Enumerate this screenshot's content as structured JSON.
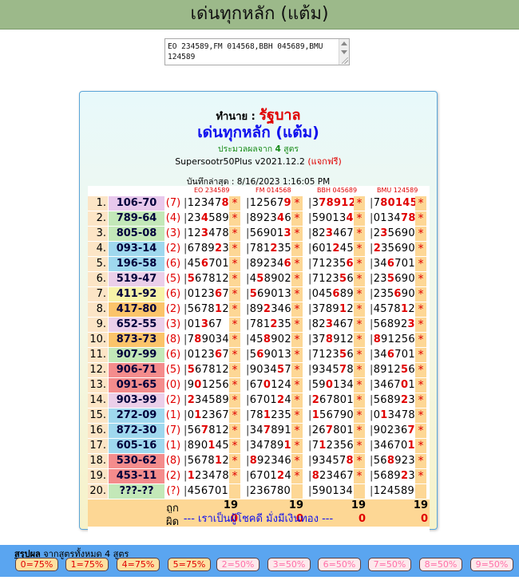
{
  "page": {
    "title": "เด่นทุกหลัก (แต้ม)"
  },
  "input": {
    "value": "EO 234589,FM 014568,BBH 045689,BMU 124589"
  },
  "panel": {
    "agent_label": "ทำนาย :",
    "agent_name": "รัฐบาล",
    "title": "เด่นทุกหลัก (แต้ม)",
    "subtitle_pre": "ประมวลผลจาก",
    "subtitle_num": "4",
    "subtitle_post": "สูตร",
    "version": "Supersootr50Plus v2021.12.2",
    "version_note": "(แจกฟรี)",
    "saved": "บันทึกล่าสุด : 8/16/2023 1:16:05 PM",
    "headers": [
      "EO 234589",
      "FM 014568",
      "BBH 045689",
      "BMU 124589"
    ],
    "footer": "--- เราเป็นผู้โชคดี มั่งมีเงินทอง ---"
  },
  "rows": [
    {
      "n": "1.",
      "pair": "106-70",
      "color": "#e8c8ec",
      "d": "(7)",
      "cells": [
        [
          "12347",
          "8"
        ],
        [
          "12567",
          "9"
        ],
        [
          "3",
          "78912"
        ],
        [
          "7",
          "80145"
        ]
      ],
      "stars": [
        1,
        1,
        1,
        1
      ]
    },
    {
      "n": "2.",
      "pair": "789-64",
      "color": "#c3e8b8",
      "d": "(4)",
      "cells": [
        [
          "23",
          "4",
          "589"
        ],
        [
          "8923",
          "4",
          "6"
        ],
        [
          "59013",
          "4"
        ],
        [
          "0134",
          "78"
        ]
      ],
      "stars": [
        1,
        1,
        1,
        1
      ]
    },
    {
      "n": "3.",
      "pair": "805-08",
      "color": "#c3e8b8",
      "d": "(3)",
      "cells": [
        [
          "12",
          "3",
          "478"
        ],
        [
          "56901",
          "3"
        ],
        [
          "82",
          "3",
          "467"
        ],
        [
          "2",
          "3",
          "5690"
        ]
      ],
      "stars": [
        1,
        1,
        1,
        1
      ]
    },
    {
      "n": "4.",
      "pair": "093-14",
      "color": "#9fd8ee",
      "d": "(2)",
      "cells": [
        [
          "6789",
          "2",
          "3"
        ],
        [
          "781",
          "2",
          "35"
        ],
        [
          "601",
          "2",
          "45"
        ],
        [
          "",
          "2",
          "35690"
        ]
      ],
      "stars": [
        1,
        1,
        1,
        1
      ]
    },
    {
      "n": "5.",
      "pair": "196-58",
      "color": "#9fd8ee",
      "d": "(6)",
      "cells": [
        [
          "45",
          "6",
          "701"
        ],
        [
          "89234",
          "6"
        ],
        [
          "71235",
          "6"
        ],
        [
          "34",
          "6",
          "701"
        ]
      ],
      "stars": [
        1,
        1,
        1,
        1
      ]
    },
    {
      "n": "6.",
      "pair": "519-47",
      "color": "#ebcfe9",
      "d": "(5)",
      "cells": [
        [
          "",
          "5",
          "67812"
        ],
        [
          "4",
          "5",
          "8902"
        ],
        [
          "7123",
          "5",
          "6"
        ],
        [
          "23",
          "5",
          "690"
        ]
      ],
      "stars": [
        1,
        1,
        1,
        1
      ]
    },
    {
      "n": "7.",
      "pair": "411-92",
      "color": "#f7f3a8",
      "d": "(6)",
      "cells": [
        [
          "0123",
          "6",
          "7"
        ],
        [
          "",
          "5",
          "69013"
        ],
        [
          "045",
          "6",
          "89"
        ],
        [
          "235",
          "6",
          "90"
        ]
      ],
      "stars": [
        1,
        1,
        1,
        1
      ]
    },
    {
      "n": "8.",
      "pair": "417-80",
      "color": "#fbc46a",
      "d": "(2)",
      "cells": [
        [
          "5678",
          "1",
          "2"
        ],
        [
          "89",
          "2",
          "346"
        ],
        [
          "3789",
          "1",
          "2"
        ],
        [
          "4578",
          "1",
          "2"
        ]
      ],
      "stars": [
        1,
        1,
        1,
        1
      ]
    },
    {
      "n": "9.",
      "pair": "652-55",
      "color": "#ebcfe9",
      "d": "(3)",
      "cells": [
        [
          "01",
          "3",
          "67"
        ],
        [
          "781",
          "2",
          "35"
        ],
        [
          "82",
          "3",
          "467"
        ],
        [
          "56892",
          "3"
        ]
      ],
      "stars": [
        1,
        1,
        1,
        1
      ]
    },
    {
      "n": "10.",
      "pair": "873-73",
      "color": "#fbc46a",
      "d": "(8)",
      "cells": [
        [
          "7",
          "8",
          "9034"
        ],
        [
          "45",
          "8",
          "902"
        ],
        [
          "37",
          "8",
          "912"
        ],
        [
          "",
          "8",
          "91256"
        ]
      ],
      "stars": [
        1,
        1,
        1,
        1
      ]
    },
    {
      "n": "11.",
      "pair": "907-99",
      "color": "#c3e8b8",
      "d": "(6)",
      "cells": [
        [
          "0123",
          "6",
          "7"
        ],
        [
          "5",
          "6",
          "9013"
        ],
        [
          "7123",
          "5",
          "6"
        ],
        [
          "34",
          "6",
          "701"
        ]
      ],
      "stars": [
        1,
        1,
        1,
        1
      ]
    },
    {
      "n": "12.",
      "pair": "906-71",
      "color": "#f48c8c",
      "d": "(5)",
      "cells": [
        [
          "",
          "5",
          "67812"
        ],
        [
          "9034",
          "5",
          "7"
        ],
        [
          "9345",
          "7",
          "8"
        ],
        [
          "8912",
          "5",
          "6"
        ]
      ],
      "stars": [
        1,
        1,
        1,
        1
      ]
    },
    {
      "n": "13.",
      "pair": "091-65",
      "color": "#f48c8c",
      "d": "(0)",
      "cells": [
        [
          "9",
          "0",
          "1256"
        ],
        [
          "67",
          "0",
          "124"
        ],
        [
          "59",
          "0",
          "134"
        ],
        [
          "3467",
          "0",
          "1"
        ]
      ],
      "stars": [
        1,
        1,
        1,
        1
      ]
    },
    {
      "n": "14.",
      "pair": "903-99",
      "color": "#ebcfe9",
      "d": "(2)",
      "cells": [
        [
          "",
          "2",
          "34589"
        ],
        [
          "6701",
          "2",
          "4"
        ],
        [
          "",
          "2",
          "67801"
        ],
        [
          "5689",
          "2",
          "3"
        ]
      ],
      "stars": [
        1,
        1,
        1,
        1
      ]
    },
    {
      "n": "15.",
      "pair": "272-09",
      "color": "#9fd8ee",
      "d": "(1)",
      "cells": [
        [
          "0",
          "1",
          "2367"
        ],
        [
          "78",
          "1",
          "235"
        ],
        [
          "",
          "1",
          "56790"
        ],
        [
          "0",
          "1",
          "3478"
        ]
      ],
      "stars": [
        1,
        1,
        1,
        1
      ]
    },
    {
      "n": "16.",
      "pair": "872-30",
      "color": "#9fd8ee",
      "d": "(7)",
      "cells": [
        [
          "56",
          "7",
          "812"
        ],
        [
          "34",
          "7",
          "891"
        ],
        [
          "26",
          "7",
          "801"
        ],
        [
          "90236",
          "7"
        ]
      ],
      "stars": [
        1,
        1,
        1,
        1
      ]
    },
    {
      "n": "17.",
      "pair": "605-16",
      "color": "#9fd8ee",
      "d": "(1)",
      "cells": [
        [
          "890",
          "1",
          "45"
        ],
        [
          "34789",
          "1"
        ],
        [
          "7",
          "1",
          "2356"
        ],
        [
          "34670",
          "1"
        ]
      ],
      "stars": [
        1,
        1,
        1,
        1
      ]
    },
    {
      "n": "18.",
      "pair": "530-62",
      "color": "#f48c8c",
      "d": "(8)",
      "cells": [
        [
          "5678",
          "1",
          "2"
        ],
        [
          "",
          "8",
          "92346"
        ],
        [
          "93457",
          "8"
        ],
        [
          "56",
          "8",
          "923"
        ]
      ],
      "stars": [
        1,
        1,
        1,
        1
      ]
    },
    {
      "n": "19.",
      "pair": "453-11",
      "color": "#f48c8c",
      "d": "(2)",
      "cells": [
        [
          "",
          "1",
          "23478"
        ],
        [
          "6701",
          "2",
          "4"
        ],
        [
          "",
          "8",
          "23467"
        ],
        [
          "5689",
          "2",
          "3"
        ]
      ],
      "stars": [
        1,
        1,
        1,
        1
      ]
    },
    {
      "n": "20.",
      "pair": "???-??",
      "color": "#c3e8b8",
      "d": "(?)",
      "cells": [
        [
          "456701"
        ],
        [
          "236780"
        ],
        [
          "590134"
        ],
        [
          "124589"
        ]
      ],
      "stars": [
        0,
        0,
        0,
        0
      ]
    }
  ],
  "summary": {
    "hit_label": "ถูก",
    "miss_label": "ผิด",
    "hits": [
      "19",
      "19",
      "19",
      "19"
    ],
    "misses": [
      "0",
      "0",
      "0",
      "0"
    ]
  },
  "bottom": {
    "title": "สรุปผล",
    "subtitle": "จากสูตรทั้งหมด 4 สูตร",
    "chips": [
      {
        "label": "0=75%",
        "hot": true
      },
      {
        "label": "1=75%",
        "hot": true
      },
      {
        "label": "4=75%",
        "hot": true
      },
      {
        "label": "5=75%",
        "hot": true
      },
      {
        "label": "2=50%",
        "hot": false
      },
      {
        "label": "3=50%",
        "hot": false
      },
      {
        "label": "6=50%",
        "hot": false
      },
      {
        "label": "7=50%",
        "hot": false
      },
      {
        "label": "8=50%",
        "hot": false
      },
      {
        "label": "9=50%",
        "hot": false
      }
    ]
  }
}
